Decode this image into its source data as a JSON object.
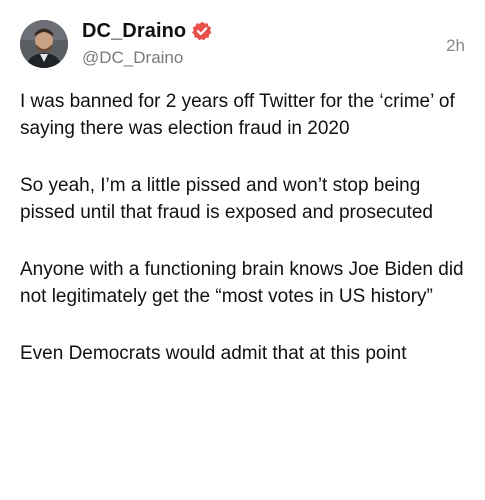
{
  "post": {
    "author": {
      "display_name": "DC_Draino",
      "handle": "@DC_Draino",
      "verified_icon": "verified-badge-icon",
      "verified_color": "#e8514a"
    },
    "timestamp": "2h",
    "paragraphs": [
      "I was banned for 2 years off Twitter for the ‘crime’ of saying there was election fraud in 2020",
      "So yeah, I’m a little pissed and won’t stop being pissed until that fraud is exposed and prosecuted",
      "Anyone with a functioning brain knows Joe Biden did not legitimately get the “most votes in US history”",
      "Even Democrats would admit that at this point"
    ]
  }
}
